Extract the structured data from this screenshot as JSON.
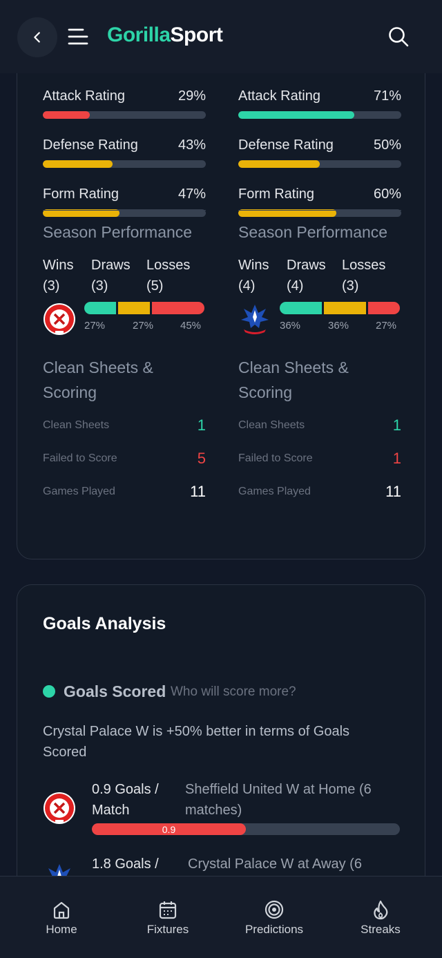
{
  "header": {
    "logo_primary": "Gorilla",
    "logo_secondary": "Sport"
  },
  "team_stats": [
    {
      "ratings": [
        {
          "label": "Attack Rating",
          "value": "29%",
          "fill": 0.29,
          "color": "#ef4444"
        },
        {
          "label": "Defense Rating",
          "value": "43%",
          "fill": 0.43,
          "color": "#eab308"
        },
        {
          "label": "Form Rating",
          "value": "47%",
          "fill": 0.47,
          "color": "#eab308"
        }
      ],
      "season_title": "Season Performance",
      "wins_label": "Wins",
      "wins_count": "(3)",
      "draws_label": "Draws",
      "draws_count": "(3)",
      "losses_label": "Losses",
      "losses_count": "(5)",
      "win_pct": "27%",
      "draw_pct": "27%",
      "loss_pct": "45%",
      "share": {
        "win": 0.27,
        "draw": 0.27,
        "loss": 0.45
      },
      "cs_title": "Clean Sheets & Scoring",
      "clean_sheets_label": "Clean Sheets",
      "clean_sheets": "1",
      "failed_label": "Failed to Score",
      "failed": "5",
      "games_label": "Games Played",
      "games": "11"
    },
    {
      "ratings": [
        {
          "label": "Attack Rating",
          "value": "71%",
          "fill": 0.71,
          "color": "#2dd4a8"
        },
        {
          "label": "Defense Rating",
          "value": "50%",
          "fill": 0.5,
          "color": "#eab308"
        },
        {
          "label": "Form Rating",
          "value": "60%",
          "fill": 0.6,
          "color": "#eab308"
        }
      ],
      "season_title": "Season Performance",
      "wins_label": "Wins",
      "wins_count": "(4)",
      "draws_label": "Draws",
      "draws_count": "(4)",
      "losses_label": "Losses",
      "losses_count": "(3)",
      "win_pct": "36%",
      "draw_pct": "36%",
      "loss_pct": "27%",
      "share": {
        "win": 0.36,
        "draw": 0.36,
        "loss": 0.27
      },
      "cs_title": "Clean Sheets & Scoring",
      "clean_sheets_label": "Clean Sheets",
      "clean_sheets": "1",
      "failed_label": "Failed to Score",
      "failed": "1",
      "games_label": "Games Played",
      "games": "11"
    }
  ],
  "goals_analysis": {
    "title": "Goals Analysis",
    "section_label": "Goals Scored",
    "section_sub": "Who will score more?",
    "summary": "Crystal Palace W is +50% better in terms of Goals Scored",
    "rows": [
      {
        "value": "0.9 Goals / Match",
        "desc": "Sheffield United W at Home (6 matches)",
        "bar_label": "0.9",
        "fill": 0.5
      },
      {
        "value": "1.8 Goals /",
        "desc": "Crystal Palace W at Away (6"
      }
    ]
  },
  "nav": [
    {
      "label": "Home",
      "icon": "home-icon"
    },
    {
      "label": "Fixtures",
      "icon": "calendar-icon"
    },
    {
      "label": "Predictions",
      "icon": "target-icon"
    },
    {
      "label": "Streaks",
      "icon": "flame-icon"
    }
  ],
  "colors": {
    "accent": "#2dd4a8",
    "danger": "#ef4444",
    "warning": "#eab308",
    "background": "#111827"
  }
}
